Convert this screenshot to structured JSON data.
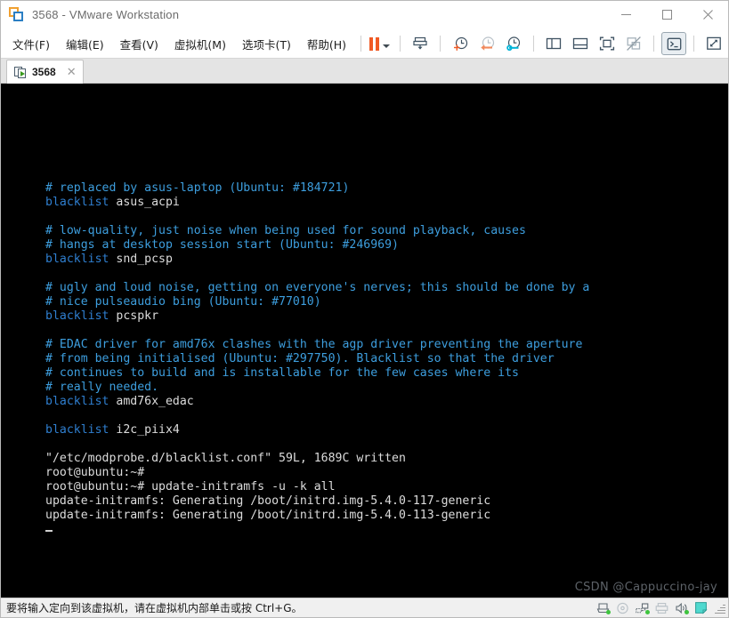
{
  "window": {
    "title": "3568 - VMware Workstation",
    "app_icon": "vmware-logo-icon",
    "minimize_label": "—",
    "maximize_label": "□",
    "close_label": "✕"
  },
  "menubar": {
    "items": [
      {
        "label": "文件(F)",
        "name": "menu-file"
      },
      {
        "label": "编辑(E)",
        "name": "menu-edit"
      },
      {
        "label": "查看(V)",
        "name": "menu-view"
      },
      {
        "label": "虚拟机(M)",
        "name": "menu-vm"
      },
      {
        "label": "选项卡(T)",
        "name": "menu-tabs"
      },
      {
        "label": "帮助(H)",
        "name": "menu-help"
      }
    ]
  },
  "toolbar": {
    "buttons": [
      {
        "name": "suspend-button",
        "icon": "pause-icon",
        "tooltip": "挂起"
      },
      {
        "name": "power-dropdown",
        "icon": "chevron-down-icon",
        "tooltip": "电源"
      },
      {
        "name": "send-ctrl-alt-del-button",
        "icon": "send-key-icon",
        "tooltip": "发送 Ctrl+Alt+Del"
      },
      {
        "name": "take-snapshot-button",
        "icon": "snapshot-add-icon",
        "tooltip": "拍快照"
      },
      {
        "name": "revert-snapshot-button",
        "icon": "snapshot-revert-icon",
        "tooltip": "恢复快照"
      },
      {
        "name": "snapshot-manager-button",
        "icon": "snapshot-manager-icon",
        "tooltip": "管理快照"
      },
      {
        "name": "show-library-button",
        "icon": "panel-left-icon",
        "tooltip": "显示库"
      },
      {
        "name": "show-thumbnails-button",
        "icon": "panel-bottom-icon",
        "tooltip": "显示缩略图"
      },
      {
        "name": "fullscreen-button",
        "icon": "fullscreen-icon",
        "tooltip": "全屏"
      },
      {
        "name": "unity-mode-button",
        "icon": "unity-disabled-icon",
        "tooltip": "Unity 模式"
      },
      {
        "name": "console-view-button",
        "icon": "terminal-icon",
        "tooltip": "控制台视图",
        "active": true
      },
      {
        "name": "stretch-guest-button",
        "icon": "expand-arrows-icon",
        "tooltip": "拉伸"
      },
      {
        "name": "stretch-dropdown",
        "icon": "chevron-down-icon",
        "tooltip": "更多"
      }
    ]
  },
  "tabs": [
    {
      "label": "3568",
      "name": "tab-3568",
      "icon": "vm-running-icon",
      "close_label": "✕",
      "active": true
    }
  ],
  "terminal": {
    "lines": [
      {
        "segments": [
          {
            "text": "# replaced by asus-laptop (Ubuntu: #184721)",
            "style": "comment"
          }
        ]
      },
      {
        "segments": [
          {
            "text": "blacklist",
            "style": "keyword"
          },
          {
            "text": " asus_acpi",
            "style": "white"
          }
        ]
      },
      {
        "segments": []
      },
      {
        "segments": [
          {
            "text": "# low-quality, just noise when being used for sound playback, causes",
            "style": "comment"
          }
        ]
      },
      {
        "segments": [
          {
            "text": "# hangs at desktop session start (Ubuntu: #246969)",
            "style": "comment"
          }
        ]
      },
      {
        "segments": [
          {
            "text": "blacklist",
            "style": "keyword"
          },
          {
            "text": " snd_pcsp",
            "style": "white"
          }
        ]
      },
      {
        "segments": []
      },
      {
        "segments": [
          {
            "text": "# ugly and loud noise, getting on everyone's nerves; this should be done by a",
            "style": "comment"
          }
        ]
      },
      {
        "segments": [
          {
            "text": "# nice pulseaudio bing (Ubuntu: #77010)",
            "style": "comment"
          }
        ]
      },
      {
        "segments": [
          {
            "text": "blacklist",
            "style": "keyword"
          },
          {
            "text": " pcspkr",
            "style": "white"
          }
        ]
      },
      {
        "segments": []
      },
      {
        "segments": [
          {
            "text": "# EDAC driver for amd76x clashes with the agp driver preventing the aperture",
            "style": "comment"
          }
        ]
      },
      {
        "segments": [
          {
            "text": "# from being initialised (Ubuntu: #297750). Blacklist so that the driver",
            "style": "comment"
          }
        ]
      },
      {
        "segments": [
          {
            "text": "# continues to build and is installable for the few cases where its",
            "style": "comment"
          }
        ]
      },
      {
        "segments": [
          {
            "text": "# really needed.",
            "style": "comment"
          }
        ]
      },
      {
        "segments": [
          {
            "text": "blacklist",
            "style": "keyword"
          },
          {
            "text": " amd76x_edac",
            "style": "white"
          }
        ]
      },
      {
        "segments": []
      },
      {
        "segments": [
          {
            "text": "blacklist",
            "style": "keyword"
          },
          {
            "text": " i2c_piix4",
            "style": "white"
          }
        ]
      },
      {
        "segments": []
      },
      {
        "segments": [
          {
            "text": "\"/etc/modprobe.d/blacklist.conf\" 59L, 1689C written",
            "style": "white"
          }
        ]
      },
      {
        "segments": [
          {
            "text": "root@ubuntu:~#",
            "style": "white"
          }
        ]
      },
      {
        "segments": [
          {
            "text": "root@ubuntu:~# update-initramfs -u -k all",
            "style": "white"
          }
        ]
      },
      {
        "segments": [
          {
            "text": "update-initramfs: Generating /boot/initrd.img-5.4.0-117-generic",
            "style": "white"
          }
        ]
      },
      {
        "segments": [
          {
            "text": "update-initramfs: Generating /boot/initrd.img-5.4.0-113-generic",
            "style": "white"
          }
        ]
      },
      {
        "segments": [],
        "cursor": true
      }
    ],
    "colors": {
      "background": "#000000",
      "comment": "#3d9ede",
      "keyword": "#2f7fd0",
      "white": "#dcdcdc"
    }
  },
  "watermark": {
    "text": "CSDN @Cappuccino-jay"
  },
  "statusbar": {
    "message": "要将输入定向到该虚拟机，请在虚拟机内部单击或按 Ctrl+G。",
    "devices": [
      {
        "name": "status-device-harddisk",
        "icon": "harddisk-icon",
        "connected": true
      },
      {
        "name": "status-device-cdrom",
        "icon": "cd-icon",
        "connected": false
      },
      {
        "name": "status-device-network",
        "icon": "network-icon",
        "connected": true
      },
      {
        "name": "status-device-printer",
        "icon": "printer-icon",
        "connected": false
      },
      {
        "name": "status-device-sound",
        "icon": "sound-icon",
        "connected": true
      },
      {
        "name": "status-device-usb",
        "icon": "usb-device-icon",
        "connected": false
      }
    ]
  }
}
